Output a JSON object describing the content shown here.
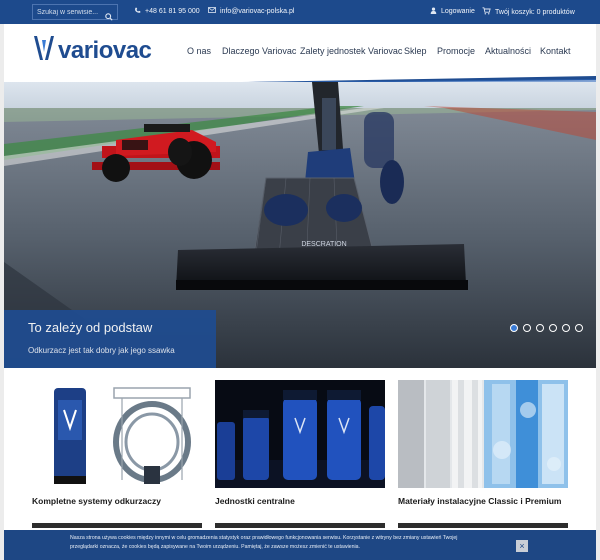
{
  "topbar": {
    "search_placeholder": "Szukaj w serwisie...",
    "phone": "+48 61 81 95 000",
    "email": "info@variovac-polska.pl",
    "login": "Logowanie",
    "cart": "Twój koszyk: 0 produktów"
  },
  "header": {
    "logo_text": "variovac",
    "nav": [
      "O nas",
      "Dlaczego Variovac",
      "Zalety jednostek Variovac",
      "Sklep",
      "Promocje",
      "Aktualności",
      "Kontakt"
    ]
  },
  "hero": {
    "title": "To zależy od podstaw",
    "subtitle": "Odkurzacz jest tak dobry jak jego ssawka",
    "slide_count": 6,
    "active_slide": 1,
    "nozzle_label": "DESCRATION"
  },
  "cards": [
    {
      "title": "Kompletne systemy odkurzaczy"
    },
    {
      "title": "Jednostki centralne"
    },
    {
      "title": "Materiały instalacyjne Classic i Premium"
    }
  ],
  "cookie": {
    "line1": "Nasza strona używa cookies między innymi w celu gromadzenia statystyk oraz prawidłowego funkcjonowania serwisu. Korzystanie z witryny bez zmiany ustawień Twojej",
    "line2": "przeglądarki oznacza, że cookies będą zapisywane na Twoim urządzeniu. Pamiętaj, że zawsze możesz zmienić te ustawienia.",
    "close": "×"
  },
  "colors": {
    "brand_blue": "#1d4a8c",
    "accent_blue": "#3a7bd5",
    "page_bg": "#ececec"
  }
}
